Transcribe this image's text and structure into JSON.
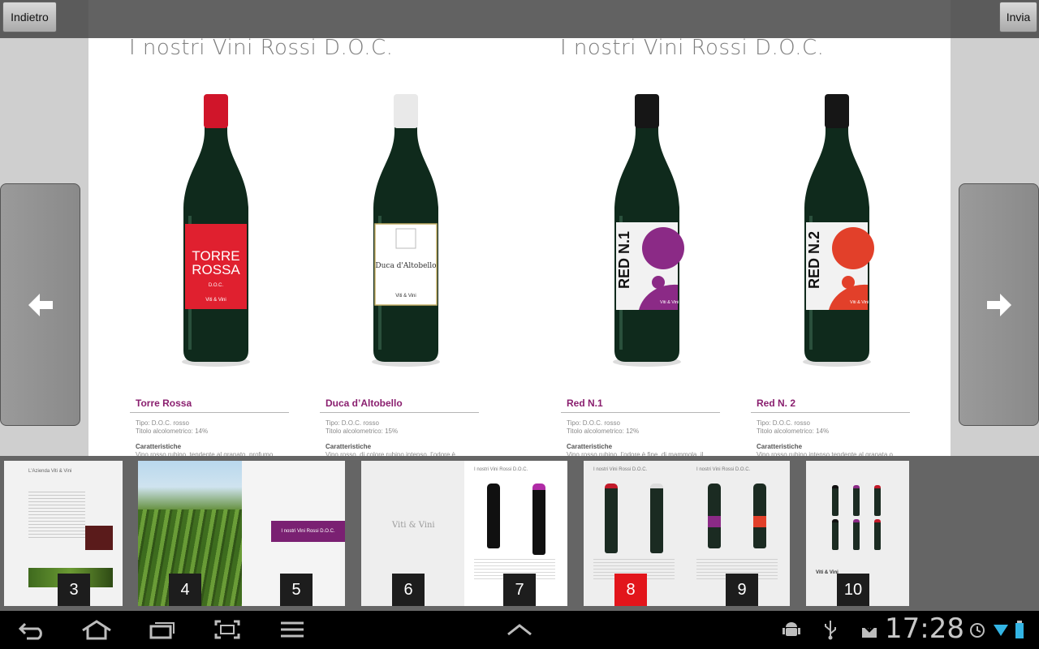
{
  "toolbar": {
    "back_label": "Indietro",
    "send_label": "Invia"
  },
  "spread": {
    "left_title": "I nostri Vini Rossi D.O.C.",
    "right_title": "I nostri Vini Rossi D.O.C.",
    "wines": [
      {
        "name": "Torre Rossa",
        "label_line1": "TORRE",
        "label_line2": "ROSSA",
        "label_small": "D.O.C.",
        "tipo": "Tipo: D.O.C. rosso",
        "titolo": "Titolo alcolometrico: 14%",
        "caratteristiche": "Caratteristiche",
        "desc": "Vino rosso rubino, tendente al granato, profumo",
        "cap_color": "#d0152a",
        "label_color": "#e0202f",
        "brand": "Viti & Vini"
      },
      {
        "name": "Duca d’Altobello",
        "label_line1": "Duca d'Altobello",
        "label_line2": "",
        "label_small": "",
        "tipo": "Tipo: D.O.C. rosso",
        "titolo": "Titolo alcolometrico: 15%",
        "caratteristiche": "Caratteristiche",
        "desc": "Vino rosso, di colore rubino intenso, l’odore è",
        "cap_color": "#e9e9e9",
        "label_color": "#ffffff",
        "brand": "Viti & Vini"
      },
      {
        "name": "Red N.1",
        "label_line1": "RED",
        "label_line2": "N.1",
        "label_small": "",
        "tipo": "Tipo: D.O.C. rosso",
        "titolo": "Titolo alcolometrico: 12%",
        "caratteristiche": "Caratteristiche",
        "desc": "Vino rosso rubino, l’odore è fine, di mammola, il",
        "cap_color": "#161616",
        "label_color": "#f2f2f2",
        "accent": "#8b2a86",
        "brand": "Viti & Vini"
      },
      {
        "name": "Red N. 2",
        "label_line1": "RED",
        "label_line2": "N.2",
        "label_small": "",
        "tipo": "Tipo: D.O.C. rosso",
        "titolo": "Titolo alcolometrico: 14%",
        "caratteristiche": "Caratteristiche",
        "desc": "Vino rosso rubino intenso tendente al granata o",
        "cap_color": "#161616",
        "label_color": "#f2f2f2",
        "accent": "#e2402a",
        "brand": "Viti & Vini"
      }
    ]
  },
  "thumbnails": {
    "pages": [
      "3",
      "4",
      "5",
      "6",
      "7",
      "8",
      "9",
      "10"
    ],
    "active_page": "8",
    "t3_title": "L'Azienda Viti & Vini",
    "t5_banner": "I nostri Vini Rossi D.O.C.",
    "t6_logo": "Viti & Vini",
    "t7_title": "I nostri Vini Rossi D.O.C.",
    "t8_title": "I nostri Vini Rossi D.O.C.",
    "t9_title": "I nostri Vini Rossi D.O.C.",
    "t10_logo": "Viti & Vini"
  },
  "status": {
    "clock": "17:28"
  },
  "colors": {
    "accent": "#8a1f6f",
    "active": "#e2151b"
  }
}
